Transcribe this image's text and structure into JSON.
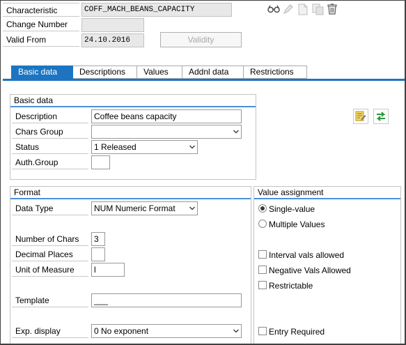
{
  "header": {
    "characteristic_label": "Characteristic",
    "characteristic_value": "COFF_MACH_BEANS_CAPACITY",
    "change_number_label": "Change Number",
    "change_number_value": "",
    "valid_from_label": "Valid From",
    "valid_from_value": "24.10.2016",
    "validity_button": "Validity"
  },
  "toolbar_icons": [
    "glasses-icon",
    "pencil-icon",
    "new-document-icon",
    "copy-document-icon",
    "trash-icon"
  ],
  "tabs": [
    {
      "label": "Basic data",
      "active": true
    },
    {
      "label": "Descriptions",
      "active": false
    },
    {
      "label": "Values",
      "active": false
    },
    {
      "label": "Addnl data",
      "active": false
    },
    {
      "label": "Restrictions",
      "active": false
    }
  ],
  "basic_data": {
    "title": "Basic data",
    "description_label": "Description",
    "description_value": "Coffee beans capacity",
    "chars_group_label": "Chars Group",
    "chars_group_value": "",
    "status_label": "Status",
    "status_value": "1 Released",
    "auth_group_label": "Auth.Group",
    "auth_group_value": ""
  },
  "format": {
    "title": "Format",
    "data_type_label": "Data Type",
    "data_type_value": "NUM Numeric Format",
    "num_chars_label": "Number of Chars",
    "num_chars_value": "3",
    "decimal_places_label": "Decimal Places",
    "decimal_places_value": "",
    "unit_label": "Unit of Measure",
    "unit_value": "l",
    "template_label": "Template",
    "template_value": "___",
    "exp_display_label": "Exp. display",
    "exp_display_value": "0 No exponent"
  },
  "value_assignment": {
    "title": "Value assignment",
    "single_value_label": "Single-value",
    "single_value_selected": true,
    "multiple_values_label": "Multiple Values",
    "multiple_values_selected": false,
    "interval_label": "Interval vals allowed",
    "interval_checked": false,
    "negative_label": "Negative Vals Allowed",
    "negative_checked": false,
    "restrictable_label": "Restrictable",
    "restrictable_checked": false,
    "entry_required_label": "Entry Required",
    "entry_required_checked": false
  },
  "colors": {
    "accent": "#1d75c1",
    "icon_green": "#2a9a3a",
    "icon_yellow": "#f1c232"
  }
}
